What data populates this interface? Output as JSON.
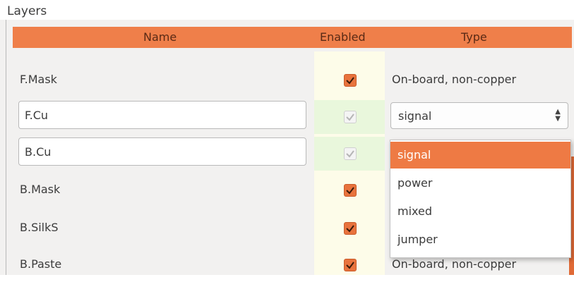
{
  "panel": {
    "title": "Layers"
  },
  "columns": {
    "name": "Name",
    "enabled": "Enabled",
    "type": "Type"
  },
  "rows": [
    {
      "name": "F.Mask",
      "enabled": true,
      "type": "On-board, non-copper"
    },
    {
      "name": "F.Cu",
      "enabled": true,
      "type": "signal"
    },
    {
      "name": "B.Cu",
      "enabled": true,
      "type": ""
    },
    {
      "name": "B.Mask",
      "enabled": true,
      "type": ""
    },
    {
      "name": "B.SilkS",
      "enabled": true,
      "type": ""
    },
    {
      "name": "B.Paste",
      "enabled": true,
      "type": "On-board, non-copper"
    }
  ],
  "dropdown": {
    "options": [
      "signal",
      "power",
      "mixed",
      "jumper"
    ],
    "selected": "signal"
  },
  "colors": {
    "accent": "#ef7f4a",
    "enabled_bg": "#fdfce9",
    "copper_enabled_bg": "#e9f7dc"
  }
}
